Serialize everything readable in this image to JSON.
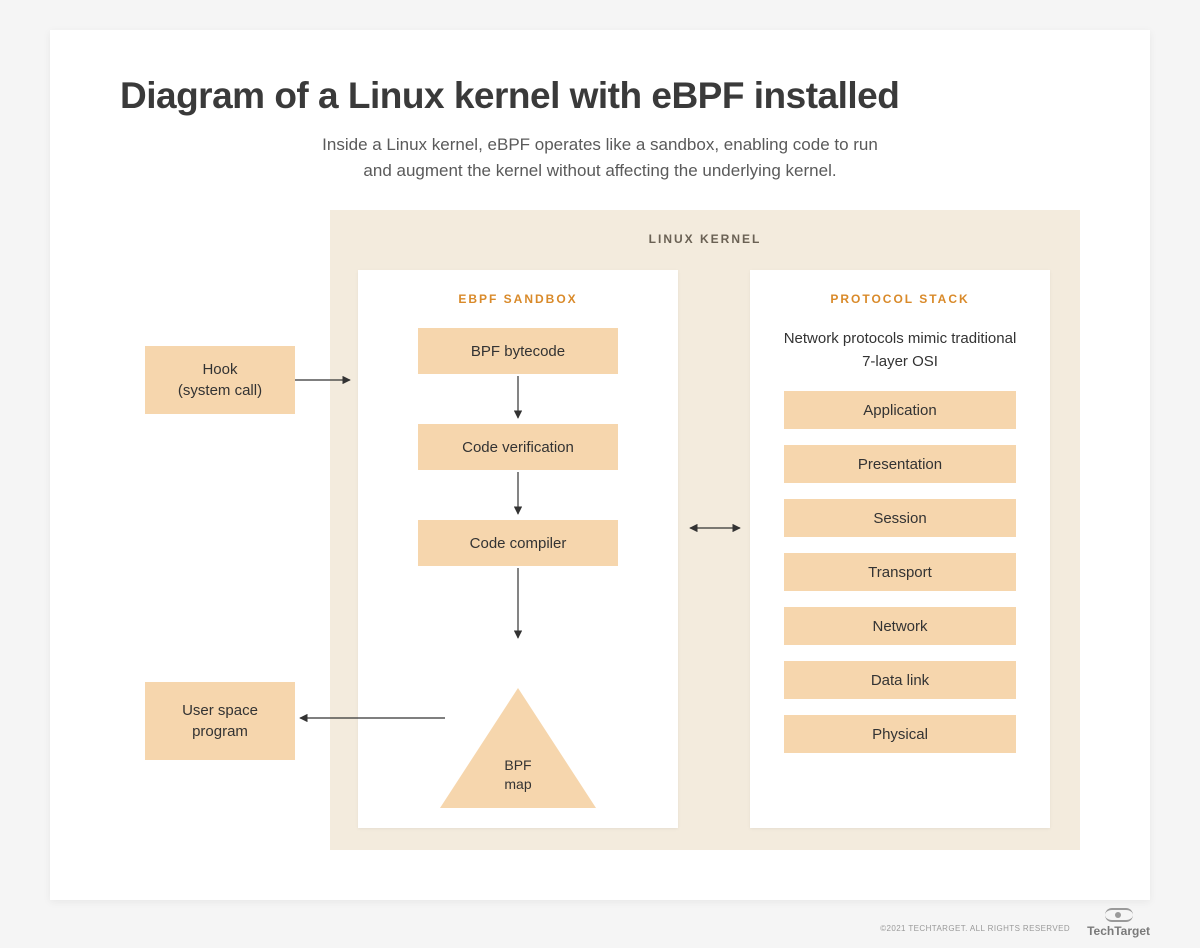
{
  "title": "Diagram of a Linux kernel with eBPF installed",
  "subtitle_line1": "Inside a Linux kernel, eBPF operates like a sandbox, enabling code to run",
  "subtitle_line2": "and augment the kernel without affecting the underlying kernel.",
  "kernel_label": "LINUX KERNEL",
  "sandbox": {
    "title": "EBPF SANDBOX",
    "steps": [
      "BPF bytecode",
      "Code verification",
      "Code compiler"
    ],
    "map_label": "BPF\nmap"
  },
  "protocol": {
    "title": "PROTOCOL STACK",
    "desc": "Network protocols mimic traditional 7-layer OSI",
    "layers": [
      "Application",
      "Presentation",
      "Session",
      "Transport",
      "Network",
      "Data link",
      "Physical"
    ]
  },
  "external": {
    "hook": "Hook\n(system call)",
    "user_space": "User space\nprogram"
  },
  "footer": {
    "copyright": "©2021 TECHTARGET. ALL RIGHTS RESERVED",
    "brand": "TechTarget"
  },
  "colors": {
    "peach": "#f6d6ad",
    "panel_bg": "#f3ebdd",
    "accent": "#d98a2a"
  }
}
